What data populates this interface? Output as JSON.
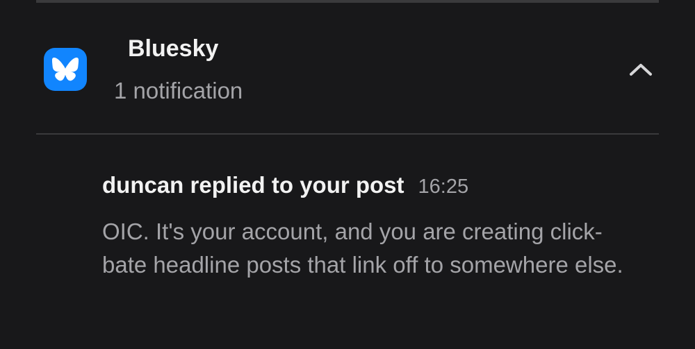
{
  "notification_group": {
    "app_name": "Bluesky",
    "summary": "1 notification",
    "app_icon": "bluesky-butterfly-icon",
    "brand_color": "#1185fe",
    "expanded": true
  },
  "notification": {
    "title": "duncan replied to your post",
    "time": "16:25",
    "text": "OIC. It's your account, and you are creating click-bate headline posts that link off to somewhere else."
  },
  "colors": {
    "background": "#18181a",
    "primary_text": "#f2f2f2",
    "secondary_text": "#a4a4a8",
    "divider": "#3a3a3c"
  }
}
